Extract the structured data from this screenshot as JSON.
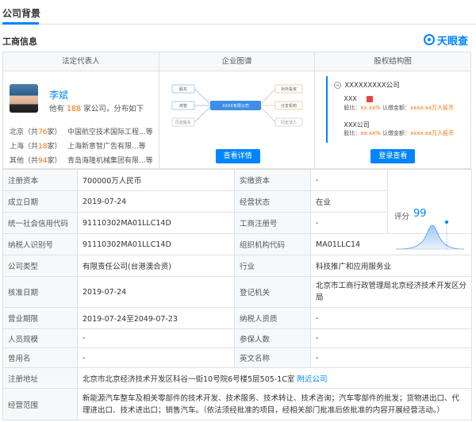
{
  "tabs": {
    "active": "公司背景"
  },
  "section": {
    "title": "工商信息",
    "logo_text": "天眼查"
  },
  "cards": {
    "legal_rep": {
      "header": "法定代表人",
      "name": "李斌",
      "sub_prefix": "他有",
      "sub_count": "188",
      "sub_suffix": "家公司，分布如下",
      "regions": [
        {
          "name_prefix": "北京（共",
          "count": "76",
          "name_suffix": "家）",
          "company": "中国航空技术国际工程...等"
        },
        {
          "name_prefix": "上海（共",
          "count": "18",
          "name_suffix": "家）",
          "company": "上海新意智广告有限...等"
        },
        {
          "name_prefix": "其他（共",
          "count": "94",
          "name_suffix": "家）",
          "company": "青岛海隆机械集团有限...等"
        }
      ]
    },
    "graph": {
      "header": "企业图谱",
      "nodes": {
        "left1": "股东",
        "left2": "高管",
        "left3": "历史股东",
        "center": "XXXX有限公司",
        "right1": "对外投资",
        "right2": "分支机构",
        "right3": "历史法人"
      },
      "button": "查看详情"
    },
    "equity": {
      "header": "股权结构图",
      "root": "XXXXXXXXX公司",
      "node1": {
        "name": "XXX",
        "ratio_label": "股比：",
        "ratio": "xx.xx%",
        "amount_label": "认缴金额：",
        "amount": "xxxx.xx万人民币"
      },
      "node2": {
        "name": "XXX公司",
        "ratio_label": "股比：",
        "ratio": "xx.xx%",
        "amount_label": "认缴金额：",
        "amount": "xxxx.xx万人民币"
      },
      "button": "登录查看"
    }
  },
  "info": {
    "reg_capital": {
      "label": "注册资本",
      "value": "700000万人民币"
    },
    "paid_capital": {
      "label": "实缴资本",
      "value": "-"
    },
    "found_date": {
      "label": "成立日期",
      "value": "2019-07-24"
    },
    "status": {
      "label": "经营状态",
      "value": "在业"
    },
    "credit_code": {
      "label": "统一社会信用代码",
      "value": "91110302MA01LLC14D"
    },
    "reg_no": {
      "label": "工商注册号",
      "value": "-"
    },
    "taxpayer_id": {
      "label": "纳税人识别号",
      "value": "91110302MA01LLC14D"
    },
    "org_code": {
      "label": "组织机构代码",
      "value": "MA01LLC14"
    },
    "company_type": {
      "label": "公司类型",
      "value": "有限责任公司(台港澳合资)"
    },
    "industry": {
      "label": "行业",
      "value": "科技推广和应用服务业"
    },
    "approval_date": {
      "label": "核准日期",
      "value": "2019-07-24"
    },
    "reg_authority": {
      "label": "登记机关",
      "value": "北京市工商行政管理局北京经济技术开发区分局"
    },
    "business_term": {
      "label": "营业期限",
      "value": "2019-07-24至2049-07-23"
    },
    "taxpayer_qual": {
      "label": "纳税人资质",
      "value": "-"
    },
    "staff_size": {
      "label": "人员规模",
      "value": "-"
    },
    "insured": {
      "label": "参保人数",
      "value": "-"
    },
    "former_name": {
      "label": "曾用名",
      "value": "-"
    },
    "english_name": {
      "label": "英文名称",
      "value": "-"
    },
    "address": {
      "label": "注册地址",
      "value": "北京市北京经济技术开发区科谷一街10号院6号楼5层505-1C室",
      "link": "附近公司"
    },
    "scope": {
      "label": "经营范围",
      "value": "新能源汽车整车及相关零部件的技术开发、技术服务、技术转让、技术咨询；汽车零部件的批发；货物进出口、代理进出口、技术进出口；销售汽车。（依法须经批准的项目，经相关部门批准后依批准的内容开展经营活动。）"
    },
    "score": {
      "label": "评分",
      "value": "99"
    }
  },
  "colors": {
    "accent": "#0084ff",
    "highlight": "#ff6a00",
    "label_bg": "#f6f9fc",
    "border": "#e0e0e0"
  }
}
